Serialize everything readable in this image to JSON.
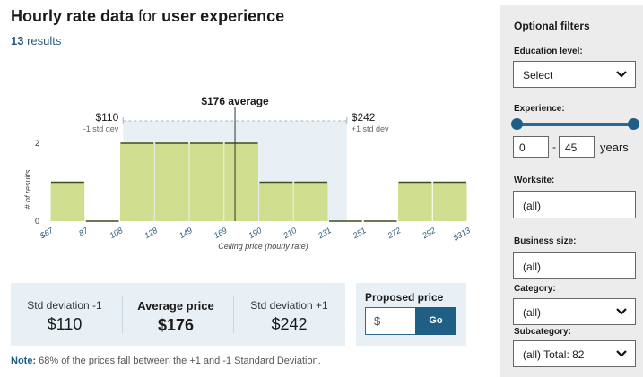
{
  "header": {
    "title_part1": "Hourly rate data",
    "title_part2": " for ",
    "title_part3": "user experience",
    "results_count": "13",
    "results_label": " results"
  },
  "chart_data": {
    "type": "bar",
    "categories": [
      "$67-87",
      "87-108",
      "108-128",
      "128-149",
      "149-169",
      "169-190",
      "190-210",
      "210-231",
      "231-251",
      "251-272",
      "272-292",
      "292-$313"
    ],
    "values": [
      1,
      0,
      2,
      2,
      2,
      2,
      1,
      1,
      0,
      0,
      1,
      1
    ],
    "tick_labels": [
      "$67",
      "87",
      "108",
      "128",
      "149",
      "169",
      "190",
      "210",
      "231",
      "251",
      "272",
      "292",
      "$313"
    ],
    "xlabel": "Ceiling price (hourly rate)",
    "ylabel": "# of results",
    "y_ticks": [
      "0",
      "2"
    ],
    "ylim": [
      0,
      2
    ],
    "average_label": "$176 average",
    "average_value": 176,
    "std_minus_value": 110,
    "std_plus_value": 242,
    "std_minus_label": "$110",
    "std_minus_sub": "-1 std dev",
    "std_plus_label": "$242",
    "std_plus_sub": "+1 std dev",
    "colors": {
      "bar": "#cfdf8f",
      "bar_top": "#3f4d1a",
      "band": "#e8f0f6",
      "avg_line": "#333333"
    }
  },
  "summary": {
    "std_minus_label": "Std deviation -1",
    "std_minus_value": "$110",
    "avg_label": "Average price",
    "avg_value": "$176",
    "std_plus_label": "Std deviation +1",
    "std_plus_value": "$242"
  },
  "proposed": {
    "label": "Proposed price",
    "placeholder": "$",
    "go_label": "Go"
  },
  "note": {
    "prefix": "Note:",
    "text": " 68% of the prices fall between the +1 and -1 Standard Deviation."
  },
  "filters": {
    "title": "Optional filters",
    "education_label": "Education level:",
    "education_value": "Select",
    "experience_label": "Experience:",
    "exp_min": "0",
    "exp_max": "45",
    "exp_dash": "-",
    "exp_unit": "years",
    "worksite_label": "Worksite:",
    "worksite_value": "(all)",
    "business_label": "Business size:",
    "business_value": "(all)",
    "category_label": "Category:",
    "category_value": "(all)",
    "subcategory_label": "Subcategory:",
    "subcategory_value": "(all) Total: 82"
  }
}
